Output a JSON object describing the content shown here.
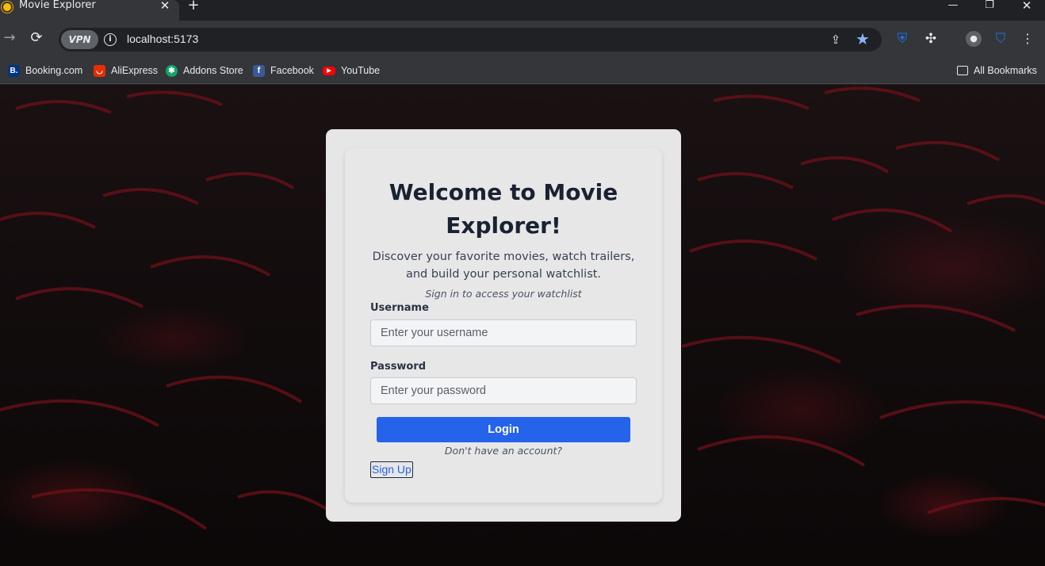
{
  "browser": {
    "tab_title": "Movie Explorer",
    "tab_close": "✕",
    "new_tab": "+",
    "window_controls": {
      "minimize": "—",
      "restore": "❐",
      "close": "✕"
    },
    "url": "localhost:5173",
    "vpn_label": "VPN",
    "bookmarks": [
      {
        "label": "Booking.com",
        "icon": "booking-icon",
        "glyph": "B."
      },
      {
        "label": "AliExpress",
        "icon": "aliexpress-icon",
        "glyph": "◡"
      },
      {
        "label": "Addons Store",
        "icon": "addons-store-icon",
        "glyph": "✱"
      },
      {
        "label": "Facebook",
        "icon": "facebook-icon",
        "glyph": "f"
      },
      {
        "label": "YouTube",
        "icon": "youtube-icon",
        "glyph": "▶"
      }
    ],
    "all_bookmarks": "All Bookmarks"
  },
  "login": {
    "title": "Welcome to Movie Explorer!",
    "subtitle": "Discover your favorite movies, watch trailers, and build your personal watchlist.",
    "tagline": "Sign in to access your watchlist",
    "username_label": "Username",
    "username_placeholder": "Enter your username",
    "password_label": "Password",
    "password_placeholder": "Enter your password",
    "login_button": "Login",
    "no_account_text": "Don't have an account?",
    "signup_button": "Sign Up"
  },
  "colors": {
    "primary_button": "#2563eb",
    "card_background": "#e6e6e7",
    "browser_chrome": "#35363a"
  }
}
